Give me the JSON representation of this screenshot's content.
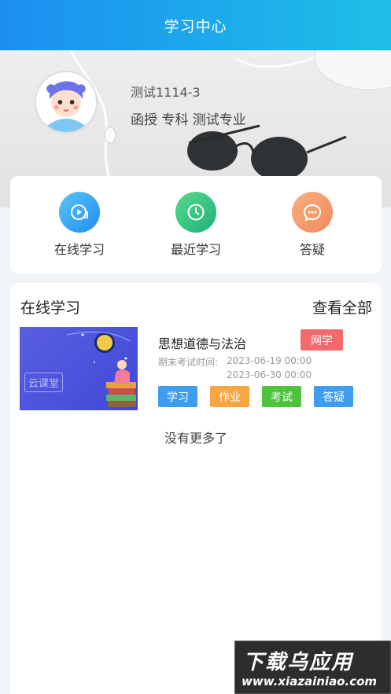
{
  "header": {
    "title": "学习中心"
  },
  "profile": {
    "name": "测试1114-3",
    "info": "函授 专科 测试专业"
  },
  "quick_menu": [
    {
      "label": "在线学习",
      "icon": "play-icon",
      "color": "#1f8ef0"
    },
    {
      "label": "最近学习",
      "icon": "clock-icon",
      "color": "#1fb27b"
    },
    {
      "label": "答疑",
      "icon": "chat-bubble-icon",
      "color": "#ef8a5b"
    }
  ],
  "courses_section": {
    "title": "在线学习",
    "view_all": "查看全部",
    "course": {
      "name": "思想道德与法治",
      "tag": "网学",
      "exam_label": "期末考试时间:",
      "date_start": "2023-06-19 00:00",
      "date_end": "2023-06-30 00:00",
      "thumb_brand": "云课堂",
      "buttons": {
        "study": "学习",
        "homework": "作业",
        "exam": "考试",
        "qa": "答疑"
      }
    },
    "end_text": "没有更多了"
  },
  "watermark": {
    "line1": "下载乌应用",
    "line2": "www.xiazainiao.com"
  }
}
